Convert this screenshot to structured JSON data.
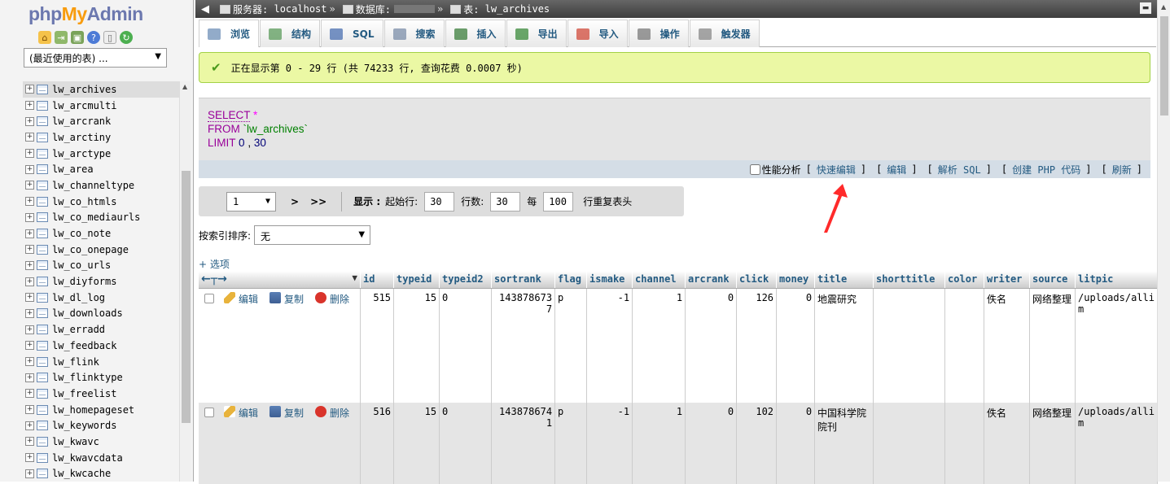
{
  "logo": {
    "php": "php",
    "my": "My",
    "admin": "Admin"
  },
  "nav_icons": [
    "home-icon",
    "exit-icon",
    "sql-icon",
    "help-icon",
    "docs-icon",
    "reload-icon"
  ],
  "recent_select": "(最近使用的表) ...",
  "tree": [
    "lw_archives",
    "lw_arcmulti",
    "lw_arcrank",
    "lw_arctiny",
    "lw_arctype",
    "lw_area",
    "lw_channeltype",
    "lw_co_htmls",
    "lw_co_mediaurls",
    "lw_co_note",
    "lw_co_onepage",
    "lw_co_urls",
    "lw_diyforms",
    "lw_dl_log",
    "lw_downloads",
    "lw_erradd",
    "lw_feedback",
    "lw_flink",
    "lw_flinktype",
    "lw_freelist",
    "lw_homepageset",
    "lw_keywords",
    "lw_kwavc",
    "lw_kwavcdata",
    "lw_kwcache"
  ],
  "breadcrumb": {
    "server_label": "服务器:",
    "server": "localhost",
    "db_label": "数据库:",
    "db": "",
    "table_label": "表:",
    "table": "lw_archives"
  },
  "tabs": [
    "浏览",
    "结构",
    "SQL",
    "搜索",
    "插入",
    "导出",
    "导入",
    "操作",
    "触发器"
  ],
  "message": "正在显示第 0 - 29 行 (共 74233 行, 查询花费 0.0007 秒)",
  "sql": {
    "select": "SELECT",
    "star": "*",
    "from": "FROM",
    "table": "`lw_archives`",
    "limit": "LIMIT",
    "offset": "0",
    "comma": ",",
    "count": "30"
  },
  "sql_actions": {
    "profiling": "性能分析",
    "inline_edit": "快速编辑",
    "edit": "编辑",
    "explain": "解析 SQL",
    "php_code": "创建 PHP 代码",
    "refresh": "刷新"
  },
  "nav": {
    "page": "1",
    "next": ">",
    "last": ">>",
    "show": "显示 :",
    "start_label": "起始行:",
    "start": "30",
    "rows_label": "行数:",
    "rows": "30",
    "every_label": "每",
    "every": "100",
    "repeat_label": "行重复表头"
  },
  "sort": {
    "label": "按索引排序:",
    "value": "无"
  },
  "options_link": "+ 选项",
  "columns": [
    "id",
    "typeid",
    "typeid2",
    "sortrank",
    "flag",
    "ismake",
    "channel",
    "arcrank",
    "click",
    "money",
    "title",
    "shorttitle",
    "color",
    "writer",
    "source",
    "litpic"
  ],
  "row_actions": {
    "edit": "编辑",
    "copy": "复制",
    "delete": "删除"
  },
  "rows": [
    {
      "id": "515",
      "typeid": "15",
      "typeid2": "0",
      "sortrank": "1438786737",
      "flag": "p",
      "ismake": "-1",
      "channel": "1",
      "arcrank": "0",
      "click": "126",
      "money": "0",
      "title": "地震研究",
      "shorttitle": "",
      "color": "",
      "writer": "佚名",
      "source": "网络整理",
      "litpic": "/uploads/allim"
    },
    {
      "id": "516",
      "typeid": "15",
      "typeid2": "0",
      "sortrank": "1438786741",
      "flag": "p",
      "ismake": "-1",
      "channel": "1",
      "arcrank": "0",
      "click": "102",
      "money": "0",
      "title": "中国科学院院刊",
      "shorttitle": "",
      "color": "",
      "writer": "佚名",
      "source": "网络整理",
      "litpic": "/uploads/allim"
    }
  ],
  "colors": {
    "link": "#235a81",
    "success_bg": "#ebf8a4",
    "annotation_arrow": "#ff2a2a"
  }
}
